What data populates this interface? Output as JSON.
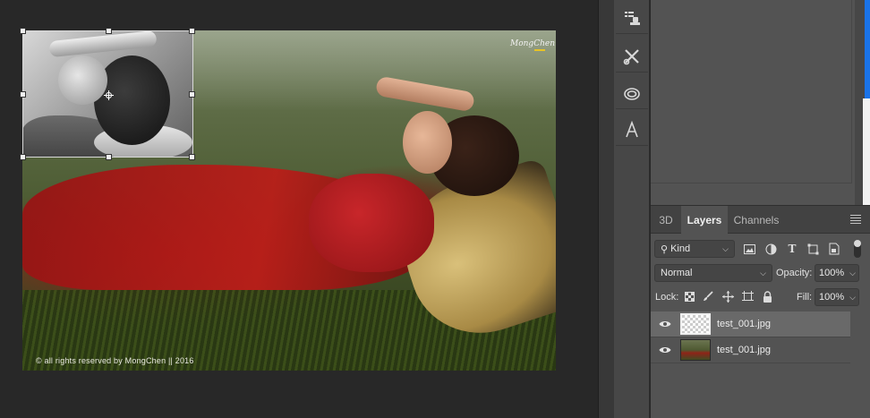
{
  "document": {
    "watermark_logo": "MongChen",
    "copyright": "© all rights reserved by MongChen || 2016"
  },
  "tool_strip": {
    "tools": [
      {
        "name": "tool-presets",
        "icon": "tool-presets-icon"
      },
      {
        "name": "brush-settings",
        "icon": "scissors-brush-icon"
      },
      {
        "name": "libraries",
        "icon": "creative-cloud-icon"
      },
      {
        "name": "character",
        "icon": "character-a-icon"
      }
    ]
  },
  "layers_panel": {
    "tabs": [
      {
        "label": "3D",
        "active": false
      },
      {
        "label": "Layers",
        "active": true
      },
      {
        "label": "Channels",
        "active": false
      }
    ],
    "filter": {
      "kind": "Kind"
    },
    "blend_mode": "Normal",
    "opacity_label": "Opacity:",
    "opacity_value": "100%",
    "lock_label": "Lock:",
    "fill_label": "Fill:",
    "fill_value": "100%",
    "layers": [
      {
        "name": "test_001.jpg",
        "selected": true,
        "visible": true,
        "thumbnail": "transparent"
      },
      {
        "name": "test_001.jpg",
        "selected": false,
        "visible": true,
        "thumbnail": "photo"
      }
    ]
  },
  "colors": {
    "canvas_bg": "#282828",
    "panel_bg": "#535353",
    "selected_row": "#696969",
    "accent_blue": "#1a73e8"
  }
}
